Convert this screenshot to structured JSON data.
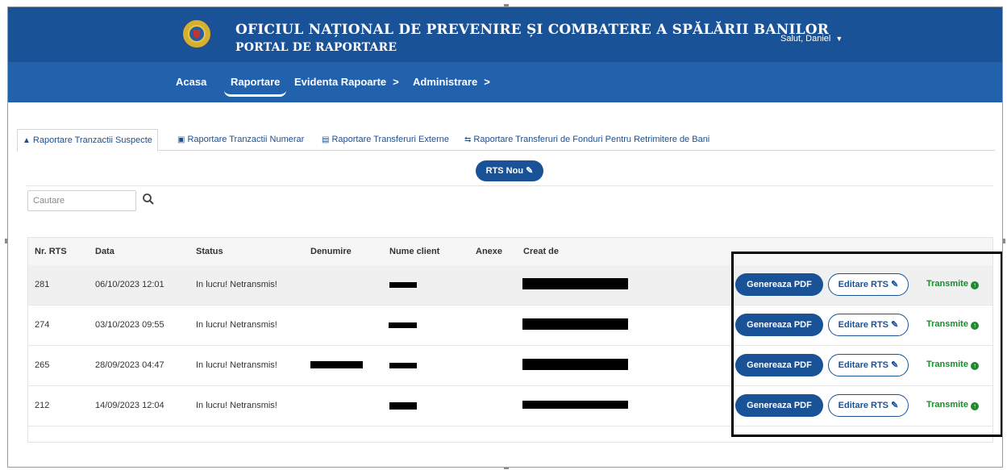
{
  "header": {
    "title_line1": "OFICIUL NAȚIONAL DE PREVENIRE ȘI COMBATERE A SPĂLĂRII BANILOR",
    "title_line2": "PORTAL DE RAPORTARE",
    "user_label": "Salut, Daniel",
    "brand_color": "#1a5298"
  },
  "nav": {
    "items": [
      {
        "label": "Acasa",
        "active": false
      },
      {
        "label": "Raportare",
        "active": true
      },
      {
        "label": "Evidenta Rapoarte",
        "active": false,
        "chevron": ">"
      },
      {
        "label": "Administrare",
        "active": false,
        "chevron": ">"
      }
    ]
  },
  "tabs": [
    {
      "label": "Raportare Tranzactii Suspecte",
      "icon": "warning-icon",
      "active": true
    },
    {
      "label": "Raportare Tranzactii Numerar",
      "icon": "cash-icon",
      "active": false
    },
    {
      "label": "Raportare Transferuri Externe",
      "icon": "card-icon",
      "active": false
    },
    {
      "label": "Raportare Transferuri de Fonduri Pentru Retrimitere de Bani",
      "icon": "transfer-icon",
      "active": false
    }
  ],
  "actions": {
    "new_label": "RTS Nou"
  },
  "search": {
    "placeholder": "Cautare",
    "value": ""
  },
  "table": {
    "columns": [
      "Nr. RTS",
      "Data",
      "Status",
      "Denumire",
      "Nume client",
      "Anexe",
      "Creat de"
    ],
    "rows": [
      {
        "nr": "281",
        "data": "06/10/2023 12:01",
        "status": "In lucru! Netransmis!"
      },
      {
        "nr": "274",
        "data": "03/10/2023 09:55",
        "status": "In lucru! Netransmis!"
      },
      {
        "nr": "265",
        "data": "28/09/2023 04:47",
        "status": "In lucru! Netransmis!"
      },
      {
        "nr": "212",
        "data": "14/09/2023 12:04",
        "status": "In lucru! Netransmis!"
      }
    ],
    "row_buttons": {
      "pdf_label": "Genereaza PDF",
      "edit_label": "Editare RTS",
      "send_label": "Transmite"
    }
  }
}
